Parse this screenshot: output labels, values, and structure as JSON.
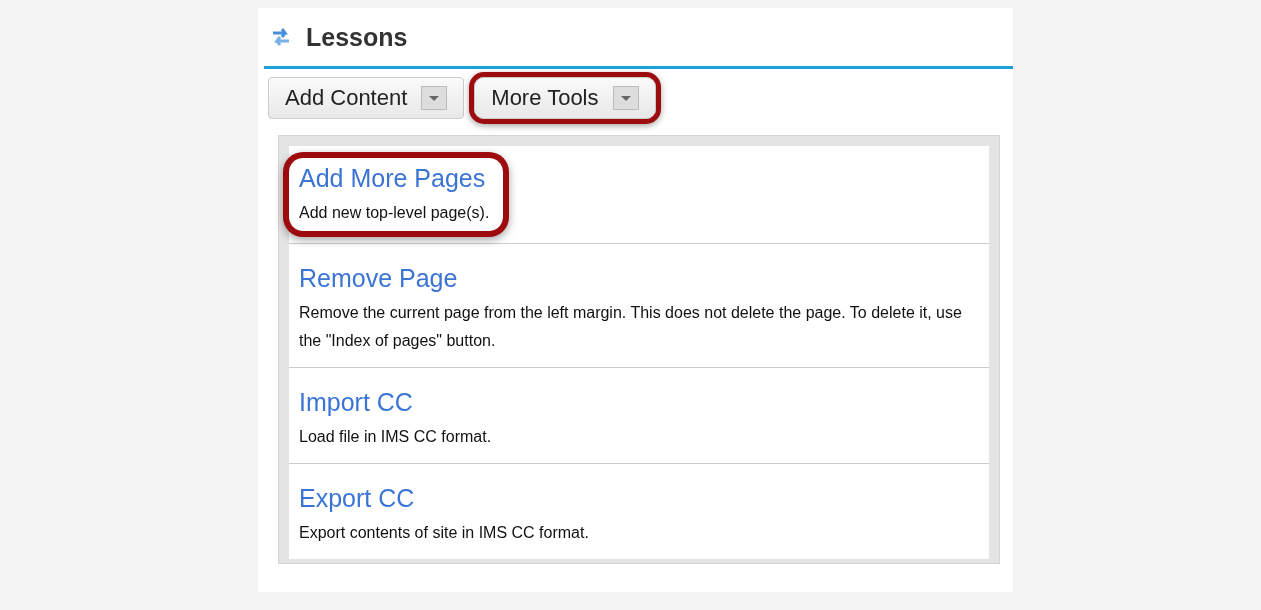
{
  "header": {
    "title": "Lessons"
  },
  "toolbar": [
    {
      "label": "Add Content",
      "highlighted": false
    },
    {
      "label": "More Tools",
      "highlighted": true
    }
  ],
  "menu": [
    {
      "title": "Add More Pages",
      "description": "Add new top-level page(s).",
      "highlighted": true
    },
    {
      "title": "Remove Page",
      "description": "Remove the current page from the left margin. This does not delete the page. To delete it, use the \"Index of pages\" button.",
      "highlighted": false
    },
    {
      "title": "Import CC",
      "description": "Load file in IMS CC format.",
      "highlighted": false
    },
    {
      "title": "Export CC",
      "description": "Export contents of site in IMS CC format.",
      "highlighted": false
    }
  ]
}
